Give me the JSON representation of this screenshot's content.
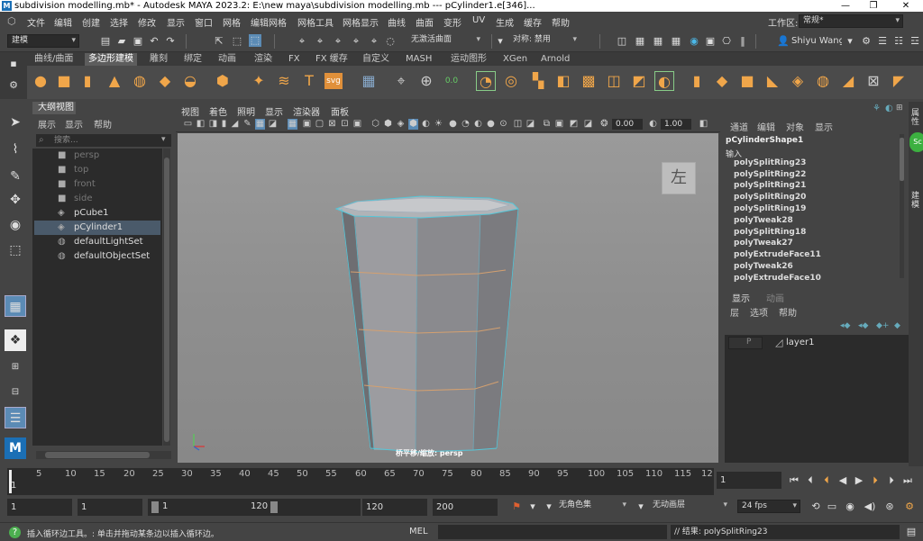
{
  "window": {
    "title": "subdivision modelling.mb* - Autodesk MAYA 2023.2: E:\\new maya\\subdivision modelling.mb   ---   pCylinder1.e[346]...",
    "logo": "M",
    "minimize": "—",
    "maximize": "❐",
    "close": "✕"
  },
  "menubar": {
    "items": [
      "文件",
      "编辑",
      "创建",
      "选择",
      "修改",
      "显示",
      "窗口",
      "网格",
      "编辑网格",
      "网格工具",
      "网格显示",
      "曲线",
      "曲面",
      "变形",
      "UV",
      "生成",
      "缓存",
      "帮助"
    ],
    "workspace_label": "工作区:",
    "workspace_value": "常规*"
  },
  "statusline": {
    "mode": "建模",
    "surface_field": "无激活曲面",
    "symmetry": "对称: 禁用",
    "user": "Shiyu Wang"
  },
  "shelf": {
    "tabs": [
      "曲线/曲面",
      "多边形建模",
      "雕刻",
      "绑定",
      "动画",
      "渲染",
      "FX",
      "FX 缓存",
      "自定义",
      "MASH",
      "运动图形",
      "XGen",
      "Arnold"
    ],
    "active_tab": "多边形建模"
  },
  "outliner": {
    "title": "大纲视图",
    "menu": [
      "展示",
      "显示",
      "帮助"
    ],
    "search_placeholder": "搜索...",
    "items": [
      {
        "label": "persp",
        "icon": "camera-icon",
        "dim": true
      },
      {
        "label": "top",
        "icon": "camera-icon",
        "dim": true
      },
      {
        "label": "front",
        "icon": "camera-icon",
        "dim": true
      },
      {
        "label": "side",
        "icon": "camera-icon",
        "dim": true
      },
      {
        "label": "pCube1",
        "icon": "mesh-icon",
        "dim": false
      },
      {
        "label": "pCylinder1",
        "icon": "mesh-icon",
        "dim": false,
        "selected": true
      },
      {
        "label": "defaultLightSet",
        "icon": "set-icon",
        "dim": false
      },
      {
        "label": "defaultObjectSet",
        "icon": "set-icon",
        "dim": false
      }
    ]
  },
  "viewport": {
    "menu": [
      "视图",
      "着色",
      "照明",
      "显示",
      "渲染器",
      "面板"
    ],
    "field_a": "0.00",
    "field_b": "1.00",
    "viewcube_label": "左",
    "camera_label": "桥平移/缩放: persp"
  },
  "channelbox": {
    "menu": [
      "通道",
      "编辑",
      "对象",
      "显示"
    ],
    "shape": "pCylinderShape1",
    "inputs_label": "输入",
    "inputs": [
      "polySplitRing23",
      "polySplitRing22",
      "polySplitRing21",
      "polySplitRing20",
      "polySplitRing19",
      "polyTweak28",
      "polySplitRing18",
      "polyTweak27",
      "polyExtrudeFace11",
      "polyTweak26",
      "polyExtrudeFace10"
    ]
  },
  "layers": {
    "tabs": [
      "显示",
      "动画"
    ],
    "menu": [
      "层",
      "选项",
      "帮助"
    ],
    "layer_p": "P",
    "layer_name": "layer1"
  },
  "timeslider": {
    "ticks": [
      "5",
      "10",
      "15",
      "20",
      "25",
      "30",
      "35",
      "40",
      "45",
      "50",
      "55",
      "60",
      "65",
      "70",
      "75",
      "80",
      "85",
      "90",
      "95",
      "100",
      "105",
      "110",
      "115",
      "12"
    ],
    "current_start": "1",
    "current_frame": "1"
  },
  "rangebar": {
    "start": "1",
    "start2": "1",
    "range_start": "1",
    "range_end": "120",
    "end": "120",
    "max_end": "200",
    "charset": "无角色集",
    "anim_layer": "无动画层",
    "fps": "24 fps"
  },
  "helpline": {
    "message": "插入循环边工具。: 单击并拖动某条边以插入循环边。",
    "mel_label": "MEL",
    "result": "// 结果: polySplitRing23"
  },
  "rightstrip": {
    "labels": [
      "属性",
      "建模"
    ]
  }
}
